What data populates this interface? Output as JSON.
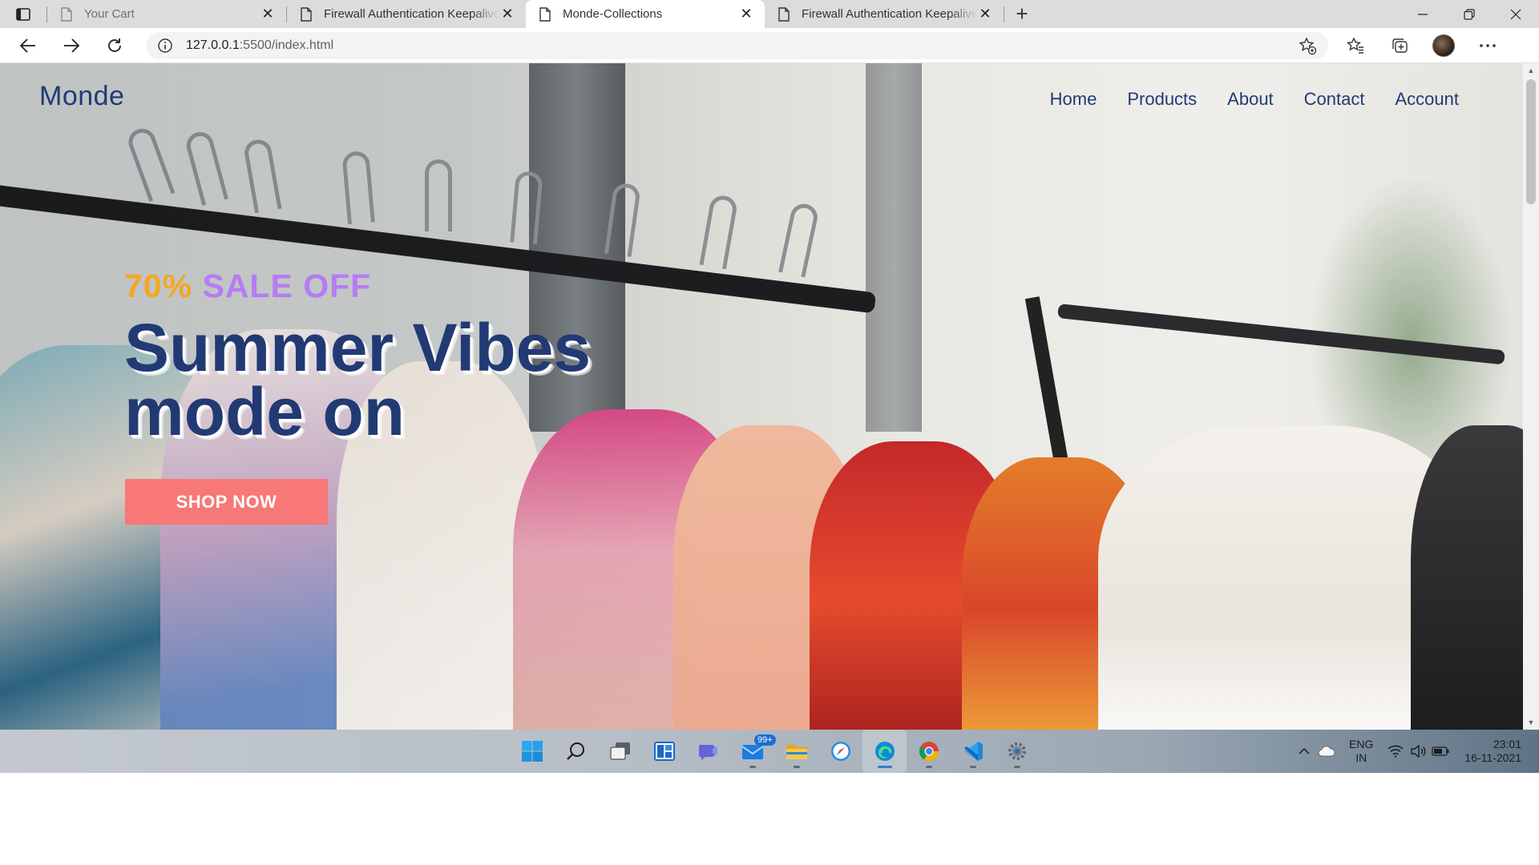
{
  "browser": {
    "tabs": [
      {
        "title": "Your Cart",
        "state": "dim"
      },
      {
        "title": "Firewall Authentication Keepalive",
        "state": "inactive"
      },
      {
        "title": "Monde-Collections",
        "state": "active"
      },
      {
        "title": "Firewall Authentication Keepalive",
        "state": "inactive"
      }
    ],
    "new_tab_label": "+",
    "address": {
      "host": "127.0.0.1",
      "path": ":5500/index.html"
    }
  },
  "site": {
    "logo": "Monde",
    "nav": [
      "Home",
      "Products",
      "About",
      "Contact",
      "Account"
    ],
    "sale_pct": "70%",
    "sale_text": "SALE OFF",
    "headline_line1": "Summer Vibes",
    "headline_line2": "mode on",
    "cta_label": "SHOP NOW",
    "colors": {
      "brand": "#223a74",
      "accent_orange": "#f5a623",
      "accent_purple": "#b57cf4",
      "cta": "#f87777"
    }
  },
  "taskbar": {
    "apps": [
      "start-icon",
      "search-icon",
      "task-view-icon",
      "widgets-icon",
      "teams-chat-icon",
      "mail-icon",
      "file-explorer-icon",
      "safari-icon",
      "edge-icon",
      "chrome-icon",
      "vscode-icon",
      "settings-icon"
    ],
    "mail_badge": "99+",
    "lang_line1": "ENG",
    "lang_line2": "IN",
    "time": "23:01",
    "date": "16-11-2021"
  }
}
